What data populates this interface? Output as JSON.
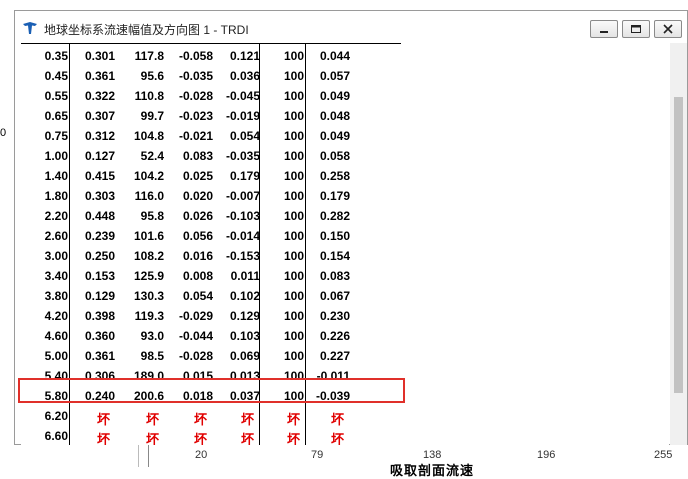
{
  "window": {
    "title": "地球坐标系流速幅值及方向图 1 - TRDI",
    "icon": "trdi-logo-icon",
    "controls": [
      "minimize-icon",
      "maximize-icon",
      "close-icon"
    ]
  },
  "background": {
    "left_marker": "0",
    "axis_ticks": [
      "20",
      "79",
      "138",
      "196",
      "255"
    ],
    "partial_title": "吸取剖面流速"
  },
  "table": {
    "rows": [
      [
        "0.35",
        "0.301",
        "117.8",
        "-0.058",
        "0.121",
        "100",
        "0.044"
      ],
      [
        "0.45",
        "0.361",
        "95.6",
        "-0.035",
        "0.036",
        "100",
        "0.057"
      ],
      [
        "0.55",
        "0.322",
        "110.8",
        "-0.028",
        "-0.045",
        "100",
        "0.049"
      ],
      [
        "0.65",
        "0.307",
        "99.7",
        "-0.023",
        "-0.019",
        "100",
        "0.048"
      ],
      [
        "0.75",
        "0.312",
        "104.8",
        "-0.021",
        "0.054",
        "100",
        "0.049"
      ],
      [
        "1.00",
        "0.127",
        "52.4",
        "0.083",
        "-0.035",
        "100",
        "0.058"
      ],
      [
        "1.40",
        "0.415",
        "104.2",
        "0.025",
        "0.179",
        "100",
        "0.258"
      ],
      [
        "1.80",
        "0.303",
        "116.0",
        "0.020",
        "-0.007",
        "100",
        "0.179"
      ],
      [
        "2.20",
        "0.448",
        "95.8",
        "0.026",
        "-0.103",
        "100",
        "0.282"
      ],
      [
        "2.60",
        "0.239",
        "101.6",
        "0.056",
        "-0.014",
        "100",
        "0.150"
      ],
      [
        "3.00",
        "0.250",
        "108.2",
        "0.016",
        "-0.153",
        "100",
        "0.154"
      ],
      [
        "3.40",
        "0.153",
        "125.9",
        "0.008",
        "0.011",
        "100",
        "0.083"
      ],
      [
        "3.80",
        "0.129",
        "130.3",
        "0.054",
        "0.102",
        "100",
        "0.067"
      ],
      [
        "4.20",
        "0.398",
        "119.3",
        "-0.029",
        "0.129",
        "100",
        "0.230"
      ],
      [
        "4.60",
        "0.360",
        "93.0",
        "-0.044",
        "0.103",
        "100",
        "0.226"
      ],
      [
        "5.00",
        "0.361",
        "98.5",
        "-0.028",
        "0.069",
        "100",
        "0.227"
      ],
      [
        "5.40",
        "0.306",
        "189.0",
        "0.015",
        "0.013",
        "100",
        "-0.011"
      ],
      [
        "5.80",
        "0.240",
        "200.6",
        "0.018",
        "0.037",
        "100",
        "-0.039"
      ],
      [
        "6.20",
        "坏",
        "坏",
        "坏",
        "坏",
        "坏",
        "坏"
      ],
      [
        "6.60",
        "坏",
        "坏",
        "坏",
        "坏",
        "坏",
        "坏"
      ]
    ],
    "highlighted_row_index": 17,
    "highlight_color": "#e0302a",
    "bad_value_color": "#e00000"
  }
}
